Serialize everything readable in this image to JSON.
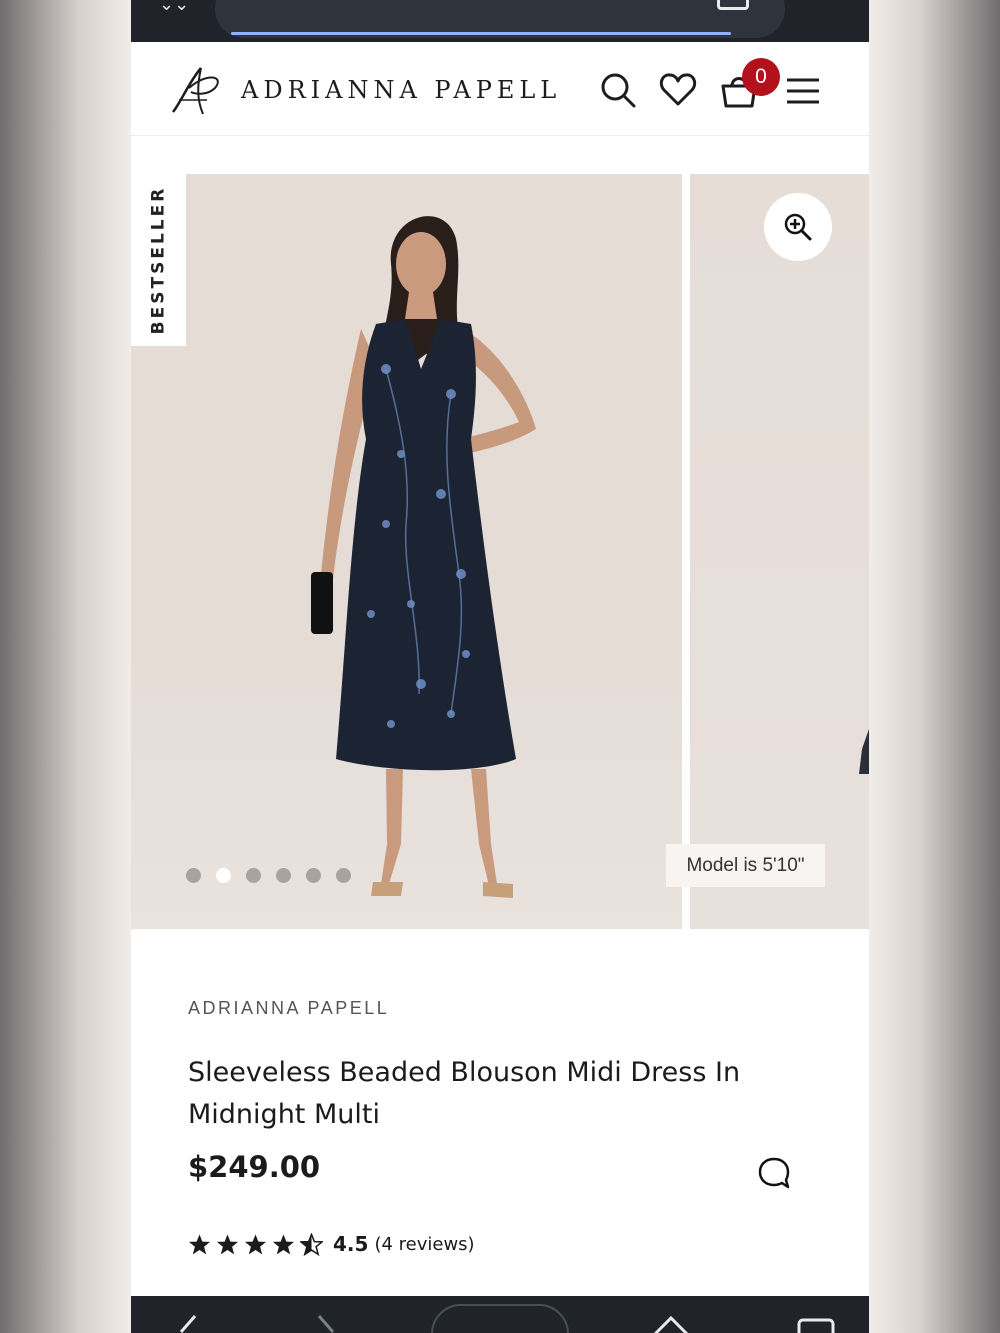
{
  "brand": {
    "name": "ADRIANNA PAPELL"
  },
  "header": {
    "cart_count": "0",
    "icons": [
      "search-icon",
      "heart-icon",
      "cart-icon",
      "menu-icon"
    ]
  },
  "gallery": {
    "badge": "BESTSELLER",
    "model_note": "Model is 5'10\"",
    "dot_count": 6,
    "active_dot": 2
  },
  "product": {
    "brand": "ADRIANNA PAPELL",
    "title": "Sleeveless Beaded Blouson Midi Dress In Midnight Multi",
    "price": "$249.00",
    "rating_value": "4.5",
    "rating_count_text": "(4 reviews)",
    "rating": 4.5
  },
  "colors": {
    "badge_red": "#b3121c",
    "browser_chrome": "#20232a",
    "text": "#1b1b1b"
  }
}
